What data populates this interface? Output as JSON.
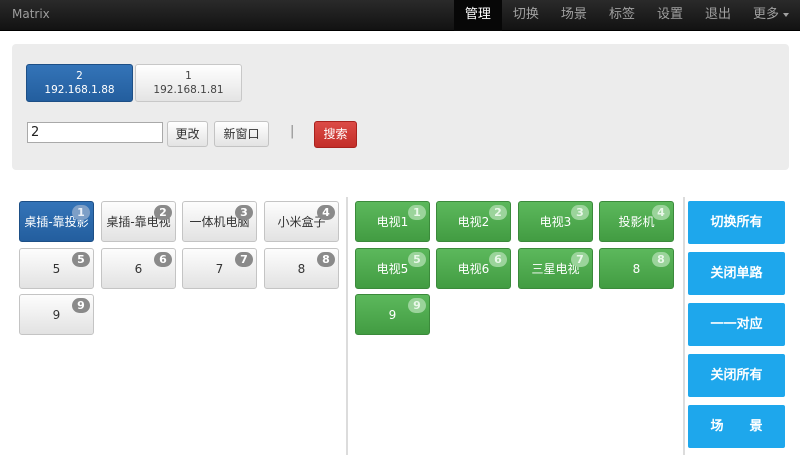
{
  "navbar": {
    "brand": "Matrix",
    "items": [
      "管理",
      "切换",
      "场景",
      "标签",
      "设置",
      "退出"
    ],
    "more_label": "更多"
  },
  "devices": [
    {
      "id": "2",
      "ip": "192.168.1.88",
      "active": true
    },
    {
      "id": "1",
      "ip": "192.168.1.81",
      "active": false
    }
  ],
  "controls": {
    "name_value": "2",
    "rename_label": "更改",
    "new_window_label": "新窗口",
    "separator": "|",
    "search_label": "搜索"
  },
  "inputs": [
    {
      "label": "桌插-靠投影",
      "badge": "1",
      "selected": true
    },
    {
      "label": "桌插-靠电视",
      "badge": "2"
    },
    {
      "label": "一体机电脑",
      "badge": "3"
    },
    {
      "label": "小米盒子",
      "badge": "4"
    },
    {
      "label": "5",
      "badge": "5"
    },
    {
      "label": "6",
      "badge": "6"
    },
    {
      "label": "7",
      "badge": "7"
    },
    {
      "label": "8",
      "badge": "8"
    },
    {
      "label": "9",
      "badge": "9"
    }
  ],
  "outputs": [
    {
      "label": "电视1",
      "badge": "1"
    },
    {
      "label": "电视2",
      "badge": "2"
    },
    {
      "label": "电视3",
      "badge": "3"
    },
    {
      "label": "投影机",
      "badge": "4"
    },
    {
      "label": "电视5",
      "badge": "5"
    },
    {
      "label": "电视6",
      "badge": "6"
    },
    {
      "label": "三星电视",
      "badge": "7"
    },
    {
      "label": "8",
      "badge": "8"
    },
    {
      "label": "9",
      "badge": "9"
    }
  ],
  "actions": [
    "切换所有",
    "关闭单路",
    "一一对应",
    "关闭所有",
    "场　　景"
  ],
  "colors": {
    "primary_blue": "#2b6cb0",
    "output_green": "#4cae4c",
    "action_blue": "#1ea7ec",
    "search_red": "#d9443f"
  }
}
